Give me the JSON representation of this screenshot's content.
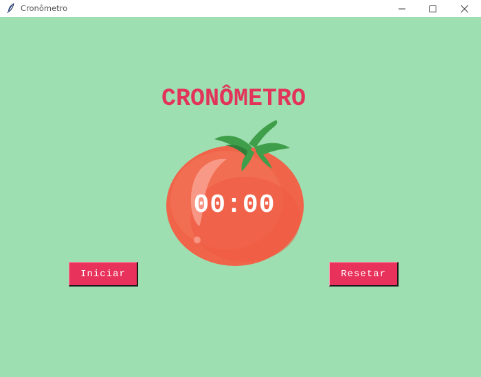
{
  "window": {
    "title": "Cronômetro",
    "controls": [
      "minimize-icon",
      "maximize-icon",
      "close-icon"
    ],
    "app_icon": "feather-icon"
  },
  "app": {
    "heading": "CRONÔMETRO",
    "timer": "00:00",
    "start_label": "Iniciar",
    "reset_label": "Resetar",
    "image": "tomato-icon"
  },
  "colors": {
    "background": "#9ddfb0",
    "accent": "#e2345a",
    "button": "#e8325b",
    "tomato": "#f0644a",
    "leaves": "#3f9e4a"
  }
}
